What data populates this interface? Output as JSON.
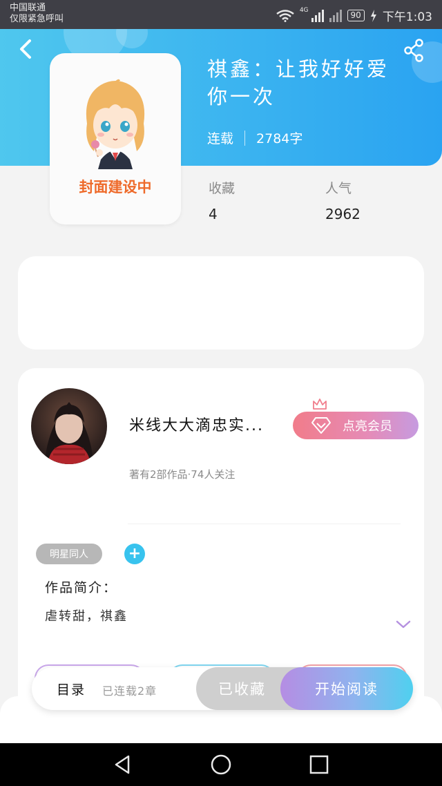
{
  "status_bar": {
    "carrier_line1": "中国联通",
    "carrier_line2": "仅限紧急呼叫",
    "network": "4G",
    "battery": "90",
    "time": "下午1:03"
  },
  "book": {
    "title": "祺鑫：让我好好爱你一次",
    "status": "连载",
    "word_count": "2784字",
    "cover_placeholder": "封面建设中",
    "stats": {
      "favorites_label": "收藏",
      "favorites_value": "4",
      "popularity_label": "人气",
      "popularity_value": "2962"
    }
  },
  "author": {
    "name": "米线大大滴忠实...",
    "info": "著有2部作品·74人关注",
    "vip_label": "点亮会员"
  },
  "tags": [
    "明星同人"
  ],
  "intro": {
    "label": "作品简介：",
    "text": "虐转甜，祺鑫"
  },
  "action_bar": {
    "toc_label": "目录",
    "chapters": "已连载2章",
    "collected_label": "已收藏",
    "read_label": "开始阅读"
  },
  "colors": {
    "header_start": "#4fc7ee",
    "header_end": "#2aa3f1",
    "cover_text": "#ee6a2a",
    "vip_start": "#f17c8a",
    "vip_end": "#c69be0",
    "add_tag": "#38c3ee",
    "read_start": "#b58de3",
    "read_end": "#4fd0ef"
  },
  "icons": [
    "back-arrow-icon",
    "share-icon",
    "diamond-icon",
    "crown-icon",
    "plus-icon",
    "chevron-down-icon",
    "nav-back-icon",
    "nav-home-icon",
    "nav-recents-icon",
    "wifi-icon",
    "signal-icon",
    "charging-icon"
  ]
}
